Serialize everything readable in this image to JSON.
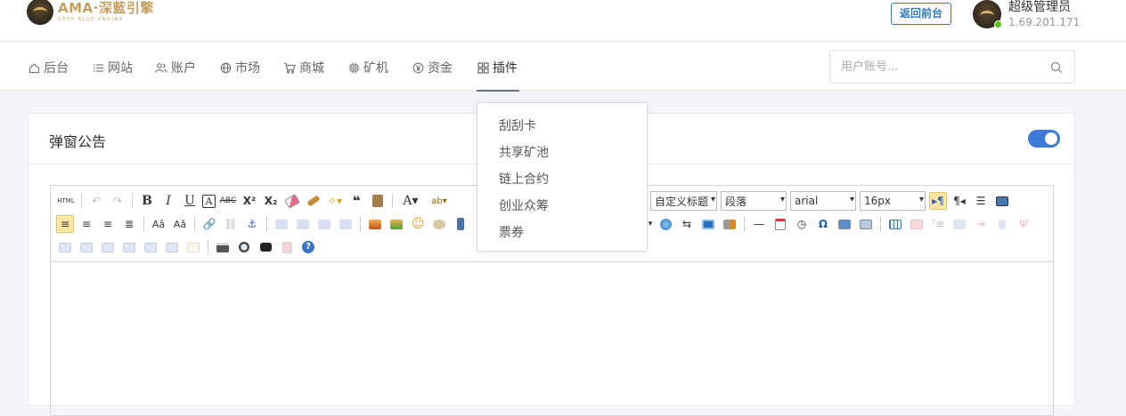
{
  "header": {
    "brand_title": "AMA·深藍引擎",
    "brand_subtitle": "DEEP BLUE ENGINE",
    "back_button": "返回前台",
    "user_name": "超级管理员",
    "user_ip": "1.69.201.171"
  },
  "nav": {
    "items": [
      {
        "label": "后台",
        "icon": "home-icon"
      },
      {
        "label": "网站",
        "icon": "list-icon"
      },
      {
        "label": "账户",
        "icon": "users-icon"
      },
      {
        "label": "市场",
        "icon": "globe-icon"
      },
      {
        "label": "商城",
        "icon": "cart-icon"
      },
      {
        "label": "矿机",
        "icon": "chip-icon"
      },
      {
        "label": "资金",
        "icon": "coin-icon"
      },
      {
        "label": "插件",
        "icon": "grid-icon"
      }
    ],
    "active": "插件",
    "search_placeholder": "用户账号..."
  },
  "plugin_menu": {
    "items": [
      "刮刮卡",
      "共享矿池",
      "链上合约",
      "创业众筹",
      "票券"
    ]
  },
  "card": {
    "title": "弹窗公告",
    "toggle_on": true
  },
  "editor": {
    "html_button": "HTML",
    "custom_heading": "自定义标题",
    "paragraph": "段落",
    "font_family": "arial",
    "font_size": "16px",
    "content": ""
  },
  "colors": {
    "accent": "#3b7ad9",
    "brand_gold": "#c4a060",
    "online": "#52c41a"
  }
}
